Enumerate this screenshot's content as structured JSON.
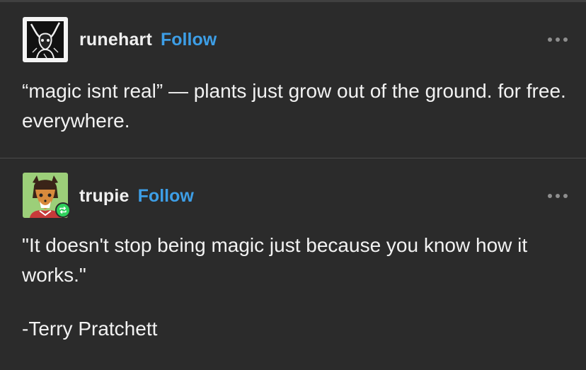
{
  "posts": [
    {
      "username": "runehart",
      "follow_label": "Follow",
      "more_icon": "ellipsis-icon",
      "avatar": "sketch-creature-avatar",
      "paragraphs": [
        "“magic isnt real” — plants just grow out of the ground. for free. everywhere."
      ]
    },
    {
      "username": "trupie",
      "follow_label": "Follow",
      "more_icon": "ellipsis-icon",
      "avatar": "cartoon-fox-avatar",
      "badge_icon": "reblog-icon",
      "paragraphs": [
        "\"It doesn't stop being magic just because you know how it works.\"",
        "-Terry Pratchett"
      ]
    }
  ],
  "colors": {
    "background": "#2b2b2b",
    "text": "#f2f2f2",
    "follow": "#3d9ee6",
    "reblog_badge": "#2fd15c",
    "more_dots": "#8e8e8e"
  }
}
